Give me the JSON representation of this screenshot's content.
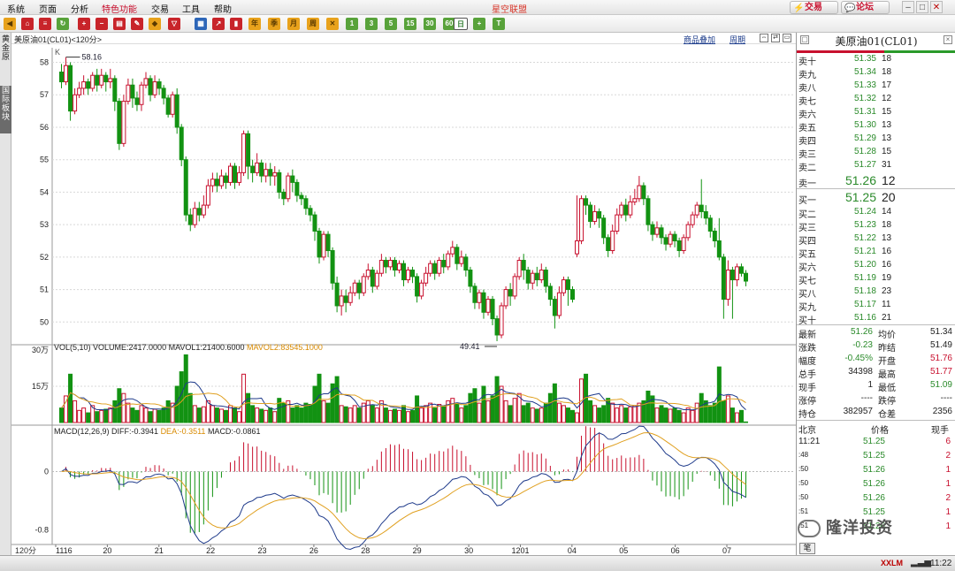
{
  "app_title": "星空联盟",
  "menu": [
    "系统",
    "页面",
    "分析",
    "特色功能",
    "交易",
    "工具",
    "帮助"
  ],
  "menu_highlight_index": 3,
  "top_buttons": {
    "trade": "交易",
    "forum": "论坛"
  },
  "toolbar": {
    "periods": [
      "1",
      "3",
      "5",
      "15",
      "30",
      "60"
    ],
    "selected_label": "日",
    "extra": [
      "周",
      "月",
      "季",
      "年"
    ]
  },
  "left_rail": {
    "tab1": "黄金 原",
    "tab2": "国际板块"
  },
  "chart_header": {
    "title": "美原油01(CL01)<120分>",
    "overlay_button": "商品叠加",
    "period_button": "周期"
  },
  "k_label": "K",
  "price_panel": {
    "y_ticks": [
      58,
      57,
      56,
      55,
      54,
      53,
      52,
      51,
      50
    ],
    "ymin": 49.3,
    "ymax": 58.45,
    "high_label": "58.16",
    "low_label": "49.41",
    "up_color": "#c8102e",
    "down_color": "#129212"
  },
  "vol_panel": {
    "legend_vol": "VOL(5,10) VOLUME:2417.0000",
    "legend_ma1": "MAVOL1:21400.6000",
    "legend_ma2": "MAVOL2:83545.1000",
    "y_ticks": [
      "30万",
      "15万"
    ],
    "max": 300000
  },
  "macd_panel": {
    "legend": "MACD(12,26,9)",
    "diff": "DIFF:-0.3941",
    "dea": "DEA:-0.3511",
    "macd": "MACD:-0.0861",
    "y_ticks": [
      "0",
      "-0.8"
    ],
    "ymax": 0.6,
    "ymin": -1.0
  },
  "x_axis": {
    "period_label": "120分",
    "labels": [
      "1116",
      "20",
      "21",
      "22",
      "23",
      "26",
      "28",
      "29",
      "30",
      "1201",
      "04",
      "05",
      "06",
      "07"
    ]
  },
  "chart_data": {
    "type": "candlestick",
    "series": "美原油01(CL01) 120分",
    "candles": [
      [
        57.7,
        57.4,
        57.95,
        57.2
      ],
      [
        57.4,
        57.9,
        58.16,
        57.3
      ],
      [
        57.9,
        56.5,
        58.0,
        56.2
      ],
      [
        56.5,
        57.0,
        57.2,
        56.4
      ],
      [
        57.0,
        57.2,
        57.4,
        56.9
      ],
      [
        57.2,
        57.4,
        57.6,
        57.0
      ],
      [
        57.4,
        57.2,
        57.5,
        57.0
      ],
      [
        57.2,
        57.6,
        57.7,
        57.1
      ],
      [
        57.6,
        57.3,
        57.8,
        57.1
      ],
      [
        57.3,
        57.6,
        57.8,
        57.2
      ],
      [
        57.6,
        57.4,
        57.7,
        57.1
      ],
      [
        57.4,
        57.5,
        57.8,
        57.2
      ],
      [
        57.5,
        56.8,
        57.6,
        56.5
      ],
      [
        56.8,
        55.5,
        56.9,
        55.3
      ],
      [
        55.5,
        56.8,
        57.0,
        55.4
      ],
      [
        56.8,
        57.3,
        57.5,
        56.7
      ],
      [
        57.3,
        56.9,
        57.5,
        56.6
      ],
      [
        56.9,
        56.7,
        57.1,
        56.5
      ],
      [
        56.7,
        57.3,
        57.4,
        56.5
      ],
      [
        57.3,
        57.5,
        57.7,
        57.2
      ],
      [
        57.5,
        57.0,
        57.6,
        56.8
      ],
      [
        57.0,
        57.4,
        57.6,
        56.9
      ],
      [
        57.4,
        57.2,
        57.5,
        57.0
      ],
      [
        57.2,
        56.9,
        57.3,
        56.7
      ],
      [
        56.9,
        56.4,
        57.0,
        56.3
      ],
      [
        56.4,
        57.0,
        57.1,
        56.3
      ],
      [
        57.0,
        56.0,
        57.2,
        55.8
      ],
      [
        56.0,
        55.0,
        56.1,
        54.8
      ],
      [
        55.0,
        53.3,
        55.1,
        53.1
      ],
      [
        53.3,
        53.0,
        53.5,
        52.8
      ],
      [
        53.0,
        53.5,
        53.7,
        52.9
      ],
      [
        53.5,
        53.3,
        53.7,
        53.1
      ],
      [
        53.3,
        53.6,
        53.9,
        53.2
      ],
      [
        53.6,
        54.2,
        54.4,
        53.5
      ],
      [
        54.2,
        54.4,
        54.6,
        54.0
      ],
      [
        54.4,
        54.2,
        54.6,
        54.0
      ],
      [
        54.2,
        54.5,
        54.7,
        54.1
      ],
      [
        54.5,
        54.3,
        54.6,
        54.1
      ],
      [
        54.3,
        54.8,
        54.9,
        54.2
      ],
      [
        54.8,
        54.3,
        54.9,
        54.1
      ],
      [
        54.3,
        54.6,
        54.8,
        54.2
      ],
      [
        54.6,
        55.8,
        55.9,
        54.5
      ],
      [
        55.8,
        54.8,
        55.9,
        54.4
      ],
      [
        54.8,
        54.6,
        55.0,
        54.3
      ],
      [
        54.6,
        54.9,
        55.2,
        54.5
      ],
      [
        54.9,
        54.5,
        55.0,
        54.3
      ],
      [
        54.5,
        54.7,
        54.9,
        54.3
      ],
      [
        54.7,
        54.5,
        54.9,
        54.2
      ],
      [
        54.5,
        54.6,
        54.8,
        54.2
      ],
      [
        54.6,
        54.0,
        54.7,
        53.8
      ],
      [
        54.0,
        53.8,
        54.1,
        53.6
      ],
      [
        53.8,
        54.5,
        54.6,
        53.7
      ],
      [
        54.5,
        54.3,
        54.7,
        54.0
      ],
      [
        54.3,
        53.9,
        54.4,
        53.7
      ],
      [
        53.9,
        53.8,
        54.0,
        53.6
      ],
      [
        53.8,
        53.5,
        53.9,
        53.3
      ],
      [
        53.5,
        53.3,
        53.6,
        53.1
      ],
      [
        53.3,
        52.8,
        53.4,
        52.5
      ],
      [
        52.8,
        52.0,
        52.9,
        51.8
      ],
      [
        52.0,
        52.7,
        52.8,
        51.9
      ],
      [
        52.7,
        52.2,
        52.8,
        52.0
      ],
      [
        52.2,
        51.2,
        52.3,
        51.0
      ],
      [
        51.2,
        50.5,
        51.4,
        50.3
      ],
      [
        50.5,
        50.8,
        51.0,
        50.2
      ],
      [
        50.8,
        50.6,
        51.0,
        50.3
      ],
      [
        50.6,
        50.9,
        51.1,
        50.5
      ],
      [
        50.9,
        51.2,
        51.3,
        50.8
      ],
      [
        51.2,
        50.9,
        51.3,
        50.7
      ],
      [
        50.9,
        51.4,
        51.5,
        50.8
      ],
      [
        51.4,
        51.6,
        51.8,
        51.3
      ],
      [
        51.6,
        51.1,
        51.7,
        50.9
      ],
      [
        51.1,
        51.5,
        51.6,
        51.0
      ],
      [
        51.5,
        51.9,
        52.1,
        51.4
      ],
      [
        51.9,
        51.7,
        52.0,
        51.5
      ],
      [
        51.7,
        51.9,
        52.0,
        51.6
      ],
      [
        51.9,
        51.6,
        52.0,
        51.4
      ],
      [
        51.6,
        51.8,
        51.9,
        51.5
      ],
      [
        51.8,
        51.3,
        51.9,
        51.1
      ],
      [
        51.3,
        51.6,
        51.7,
        51.2
      ],
      [
        51.6,
        51.4,
        51.7,
        51.2
      ],
      [
        51.4,
        50.8,
        51.5,
        50.6
      ],
      [
        50.8,
        51.2,
        51.3,
        50.7
      ],
      [
        51.2,
        51.5,
        51.7,
        51.1
      ],
      [
        51.5,
        51.8,
        51.9,
        51.4
      ],
      [
        51.8,
        51.5,
        51.9,
        51.3
      ],
      [
        51.5,
        51.9,
        52.0,
        51.4
      ],
      [
        51.9,
        51.7,
        52.1,
        51.5
      ],
      [
        51.7,
        52.1,
        52.2,
        51.6
      ],
      [
        52.1,
        52.3,
        52.5,
        52.0
      ],
      [
        52.3,
        51.8,
        52.4,
        51.6
      ],
      [
        51.8,
        52.0,
        52.2,
        51.7
      ],
      [
        52.0,
        51.6,
        52.1,
        51.4
      ],
      [
        51.6,
        51.1,
        51.7,
        50.9
      ],
      [
        51.1,
        50.6,
        51.2,
        50.4
      ],
      [
        50.6,
        50.9,
        51.0,
        50.4
      ],
      [
        50.9,
        50.3,
        51.0,
        50.1
      ],
      [
        50.3,
        50.7,
        50.8,
        50.2
      ],
      [
        50.7,
        50.1,
        50.8,
        49.9
      ],
      [
        50.1,
        49.6,
        50.2,
        49.41
      ],
      [
        49.6,
        50.5,
        50.6,
        49.5
      ],
      [
        50.5,
        51.0,
        51.1,
        50.4
      ],
      [
        51.0,
        50.8,
        51.2,
        50.5
      ],
      [
        50.8,
        51.4,
        51.5,
        50.7
      ],
      [
        51.4,
        51.9,
        52.0,
        51.3
      ],
      [
        51.9,
        51.6,
        52.1,
        51.3
      ],
      [
        51.6,
        51.2,
        51.7,
        51.0
      ],
      [
        51.2,
        51.5,
        51.6,
        51.0
      ],
      [
        51.5,
        51.3,
        51.7,
        51.1
      ],
      [
        51.3,
        51.6,
        51.8,
        51.2
      ],
      [
        51.6,
        51.1,
        51.7,
        50.9
      ],
      [
        51.1,
        50.7,
        51.2,
        50.5
      ],
      [
        50.7,
        50.2,
        50.8,
        49.8
      ],
      [
        50.2,
        50.9,
        51.1,
        50.1
      ],
      [
        50.9,
        51.3,
        51.4,
        50.8
      ],
      [
        51.3,
        51.0,
        51.4,
        50.5
      ],
      [
        51.0,
        50.7,
        51.1,
        50.6
      ],
      [
        52.1,
        52.5,
        53.9,
        52.0
      ],
      [
        52.5,
        53.8,
        53.9,
        52.4
      ],
      [
        53.8,
        53.6,
        53.9,
        53.3
      ],
      [
        53.6,
        53.1,
        53.7,
        52.9
      ],
      [
        53.1,
        53.4,
        53.6,
        53.0
      ],
      [
        53.4,
        53.2,
        53.5,
        52.9
      ],
      [
        53.2,
        52.6,
        53.3,
        52.4
      ],
      [
        52.6,
        52.2,
        52.7,
        52.0
      ],
      [
        52.2,
        52.8,
        53.0,
        52.1
      ],
      [
        52.8,
        53.3,
        53.5,
        52.7
      ],
      [
        53.3,
        53.6,
        53.7,
        53.2
      ],
      [
        53.6,
        53.3,
        53.8,
        53.1
      ],
      [
        53.3,
        53.7,
        53.9,
        53.2
      ],
      [
        53.7,
        53.8,
        54.1,
        53.6
      ],
      [
        53.8,
        54.2,
        54.5,
        53.7
      ],
      [
        54.2,
        53.8,
        54.3,
        53.6
      ],
      [
        53.8,
        53.0,
        53.9,
        52.8
      ],
      [
        53.0,
        52.7,
        53.1,
        52.5
      ],
      [
        52.7,
        52.9,
        53.1,
        52.6
      ],
      [
        52.9,
        52.6,
        53.0,
        52.4
      ],
      [
        52.6,
        52.4,
        52.7,
        52.2
      ],
      [
        52.4,
        52.7,
        52.8,
        52.3
      ],
      [
        52.7,
        52.5,
        52.8,
        52.3
      ],
      [
        52.5,
        52.2,
        52.6,
        52.0
      ],
      [
        52.2,
        52.6,
        52.7,
        52.1
      ],
      [
        52.6,
        53.0,
        53.1,
        52.5
      ],
      [
        53.0,
        53.3,
        53.4,
        52.9
      ],
      [
        53.3,
        53.6,
        53.7,
        53.2
      ],
      [
        53.6,
        53.4,
        54.4,
        53.2
      ],
      [
        53.4,
        53.2,
        53.6,
        53.0
      ],
      [
        53.2,
        52.8,
        53.3,
        52.6
      ],
      [
        52.8,
        52.5,
        52.9,
        52.3
      ],
      [
        52.5,
        52.0,
        53.2,
        51.9
      ],
      [
        52.0,
        50.7,
        52.1,
        50.1
      ],
      [
        50.7,
        51.6,
        51.9,
        50.5
      ],
      [
        51.6,
        51.3,
        51.7,
        50.1
      ],
      [
        51.3,
        51.7,
        51.8,
        51.1
      ],
      [
        51.7,
        51.5,
        51.8,
        51.4
      ],
      [
        51.5,
        51.26,
        51.6,
        51.1
      ]
    ],
    "volumes": [
      60000,
      110000,
      200000,
      90000,
      50000,
      60000,
      40000,
      70000,
      45000,
      50000,
      55000,
      60000,
      90000,
      140000,
      120000,
      80000,
      60000,
      50000,
      70000,
      60000,
      45000,
      55000,
      50000,
      60000,
      90000,
      80000,
      150000,
      210000,
      280000,
      120000,
      70000,
      60000,
      65000,
      90000,
      70000,
      60000,
      55000,
      50000,
      70000,
      60000,
      45000,
      200000,
      120000,
      70000,
      60000,
      55000,
      50000,
      60000,
      45000,
      100000,
      80000,
      90000,
      60000,
      70000,
      60000,
      80000,
      75000,
      150000,
      200000,
      90000,
      80000,
      160000,
      190000,
      70000,
      65000,
      60000,
      70000,
      60000,
      80000,
      90000,
      70000,
      60000,
      90000,
      60000,
      50000,
      55000,
      50000,
      70000,
      45000,
      50000,
      110000,
      60000,
      70000,
      80000,
      60000,
      75000,
      65000,
      90000,
      100000,
      80000,
      60000,
      70000,
      120000,
      140000,
      80000,
      150000,
      90000,
      110000,
      190000,
      150000,
      90000,
      70000,
      100000,
      120000,
      70000,
      80000,
      60000,
      55000,
      60000,
      80000,
      120000,
      160000,
      80000,
      70000,
      60000,
      50000,
      40000,
      180000,
      200000,
      90000,
      70000,
      60000,
      70000,
      100000,
      80000,
      60000,
      70000,
      60000,
      65000,
      70000,
      80000,
      90000,
      130000,
      110000,
      60000,
      70000,
      60000,
      55000,
      60000,
      50000,
      40000,
      60000,
      50000,
      80000,
      120000,
      90000,
      70000,
      80000,
      230000,
      90000,
      110000,
      60000,
      40000,
      50000,
      2417
    ]
  },
  "quote": {
    "title": "美原油01(CL01)",
    "asks": [
      {
        "label": "卖十",
        "price": "51.35",
        "vol": "18"
      },
      {
        "label": "卖九",
        "price": "51.34",
        "vol": "18"
      },
      {
        "label": "卖八",
        "price": "51.33",
        "vol": "17"
      },
      {
        "label": "卖七",
        "price": "51.32",
        "vol": "12"
      },
      {
        "label": "卖六",
        "price": "51.31",
        "vol": "15"
      },
      {
        "label": "卖五",
        "price": "51.30",
        "vol": "13"
      },
      {
        "label": "卖四",
        "price": "51.29",
        "vol": "13"
      },
      {
        "label": "卖三",
        "price": "51.28",
        "vol": "15"
      },
      {
        "label": "卖二",
        "price": "51.27",
        "vol": "31"
      },
      {
        "label": "卖一",
        "price": "51.26",
        "vol": "12"
      }
    ],
    "bids": [
      {
        "label": "买一",
        "price": "51.25",
        "vol": "20"
      },
      {
        "label": "买二",
        "price": "51.24",
        "vol": "14"
      },
      {
        "label": "买三",
        "price": "51.23",
        "vol": "18"
      },
      {
        "label": "买四",
        "price": "51.22",
        "vol": "13"
      },
      {
        "label": "买五",
        "price": "51.21",
        "vol": "16"
      },
      {
        "label": "买六",
        "price": "51.20",
        "vol": "16"
      },
      {
        "label": "买七",
        "price": "51.19",
        "vol": "19"
      },
      {
        "label": "买八",
        "price": "51.18",
        "vol": "23"
      },
      {
        "label": "买九",
        "price": "51.17",
        "vol": "11"
      },
      {
        "label": "买十",
        "price": "51.16",
        "vol": "21"
      }
    ],
    "stats": [
      {
        "l1": "最新",
        "v1": "51.26",
        "c1": "#2a8a2a",
        "l2": "均价",
        "v2": "51.34",
        "c2": "#222"
      },
      {
        "l1": "涨跌",
        "v1": "-0.23",
        "c1": "#2a8a2a",
        "l2": "昨结",
        "v2": "51.49",
        "c2": "#222"
      },
      {
        "l1": "幅度",
        "v1": "-0.45%",
        "c1": "#2a8a2a",
        "l2": "开盘",
        "v2": "51.76",
        "c2": "#c8102e"
      },
      {
        "l1": "总手",
        "v1": "34398",
        "c1": "#222",
        "l2": "最高",
        "v2": "51.77",
        "c2": "#c8102e"
      },
      {
        "l1": "现手",
        "v1": "1",
        "c1": "#222",
        "l2": "最低",
        "v2": "51.09",
        "c2": "#2a8a2a"
      },
      {
        "l1": "涨停",
        "v1": "----",
        "c1": "#222",
        "l2": "跌停",
        "v2": "----",
        "c2": "#222"
      },
      {
        "l1": "持仓",
        "v1": "382957",
        "c1": "#222",
        "l2": "仓差",
        "v2": "2356",
        "c2": "#222"
      }
    ],
    "tick_header": {
      "place": "北京",
      "price": "价格",
      "vol": "现手"
    },
    "ticks": [
      {
        "time": "11:21",
        "price": "51.25",
        "vol": "6"
      },
      {
        "time": ":48",
        "price": "51.25",
        "vol": "2"
      },
      {
        "time": ":50",
        "price": "51.26",
        "vol": "1"
      },
      {
        "time": ":50",
        "price": "51.26",
        "vol": "1"
      },
      {
        "time": ":50",
        "price": "51.26",
        "vol": "2"
      },
      {
        "time": ":51",
        "price": "51.25",
        "vol": "1"
      },
      {
        "time": ":51",
        "price": "51.26",
        "vol": "1"
      }
    ],
    "tab_label": "笔"
  },
  "watermark": "隆洋投资",
  "status": {
    "right_logo": "XXLM",
    "clock": "11:22"
  }
}
